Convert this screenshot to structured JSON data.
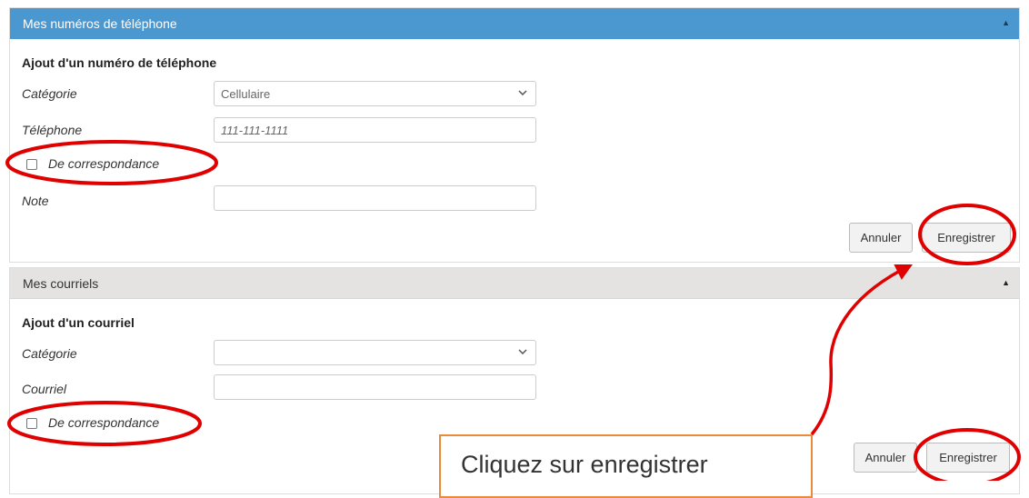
{
  "phone_panel": {
    "header": "Mes numéros de téléphone",
    "subtitle": "Ajout d'un numéro de téléphone",
    "category_label": "Catégorie",
    "category_value": "Cellulaire",
    "phone_label": "Téléphone",
    "phone_placeholder": "111-111-1111",
    "correspondence_label": "De correspondance",
    "note_label": "Note",
    "cancel_label": "Annuler",
    "save_label": "Enregistrer"
  },
  "email_panel": {
    "header": "Mes courriels",
    "subtitle": "Ajout d'un courriel",
    "category_label": "Catégorie",
    "category_value": "",
    "email_label": "Courriel",
    "correspondence_label": "De correspondance",
    "cancel_label": "Annuler",
    "save_label": "Enregistrer"
  },
  "callout": {
    "text": "Cliquez sur enregistrer"
  },
  "colors": {
    "header_blue": "#4b97cf",
    "header_grey": "#e5e2e2",
    "annotation_red": "#e00000",
    "callout_border": "#ea8a3a"
  },
  "icons": {
    "collapse": "triangle-up-icon",
    "dropdown": "chevron-down-icon"
  }
}
